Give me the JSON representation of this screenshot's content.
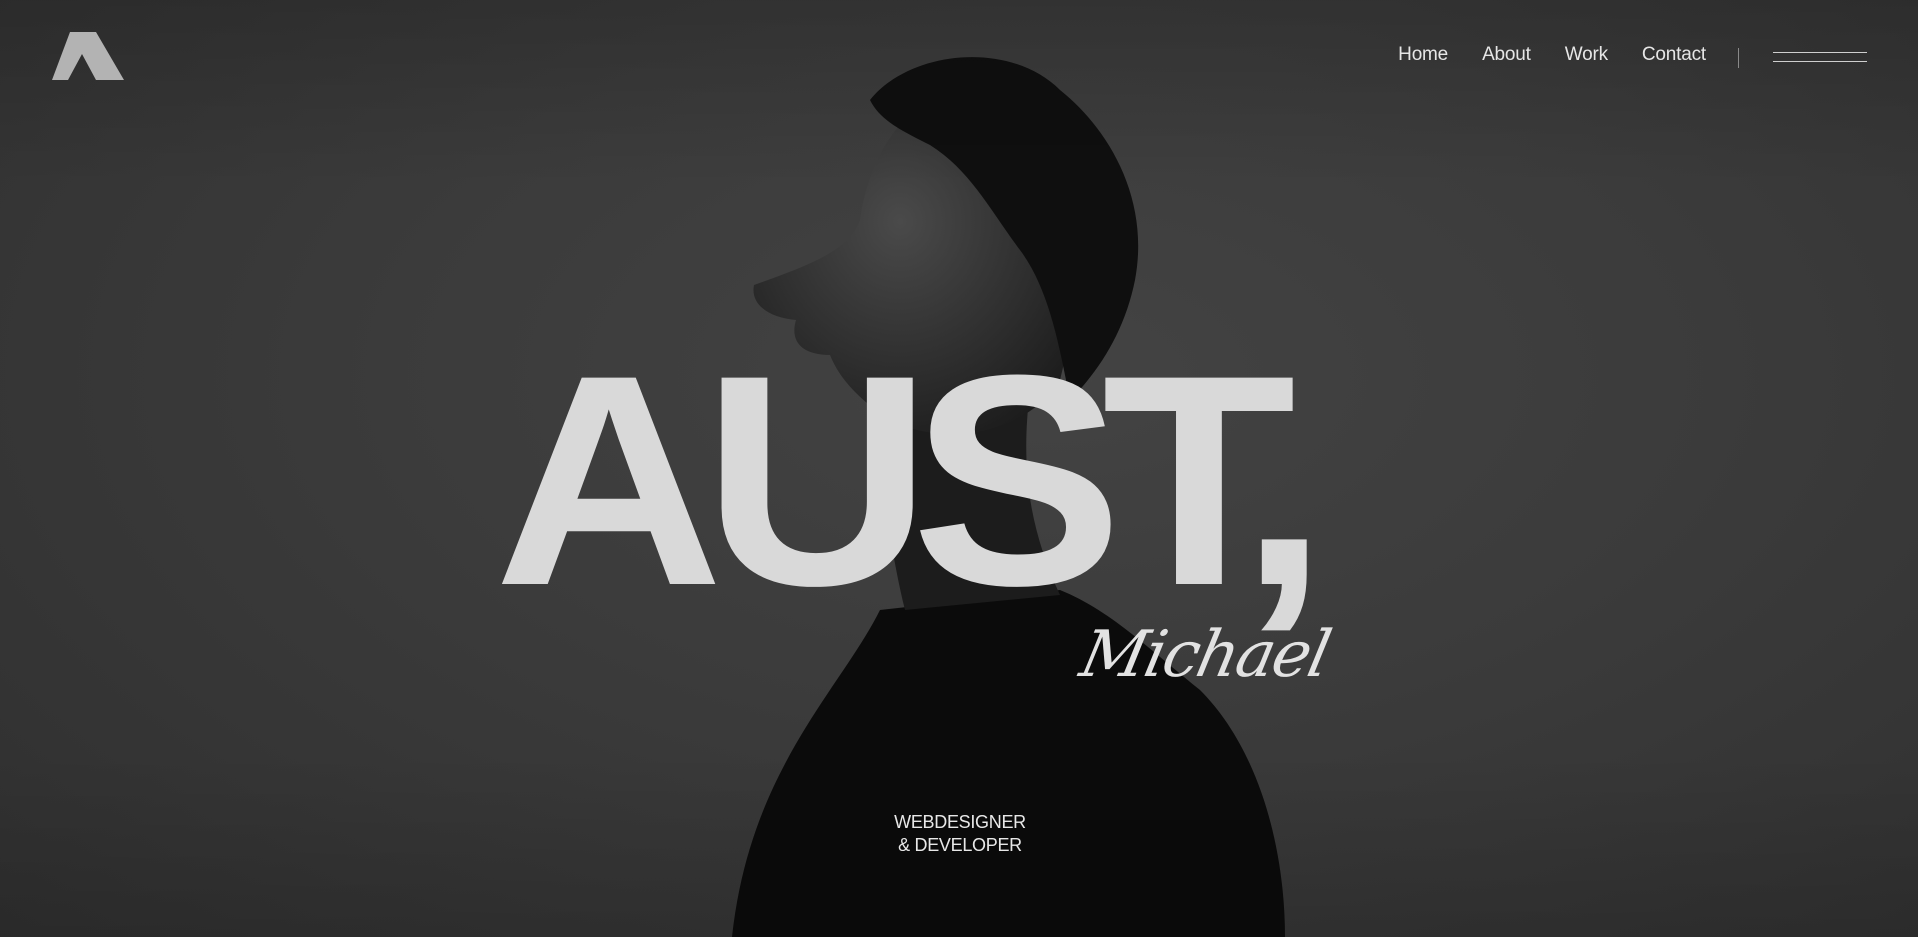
{
  "nav": {
    "items": [
      {
        "label": "Home"
      },
      {
        "label": "About"
      },
      {
        "label": "Work"
      },
      {
        "label": "Contact"
      }
    ]
  },
  "hero": {
    "surname": "AUST,",
    "firstname": "Michael",
    "role_line1": "WEBDESIGNER",
    "role_line2": "& DEVELOPER"
  },
  "icons": {
    "logo": "a-logo-icon",
    "menu": "hamburger-menu-icon"
  },
  "colors": {
    "background": "#3a3a3a",
    "text": "#d9d9d9",
    "logo": "#b3b3b3"
  }
}
